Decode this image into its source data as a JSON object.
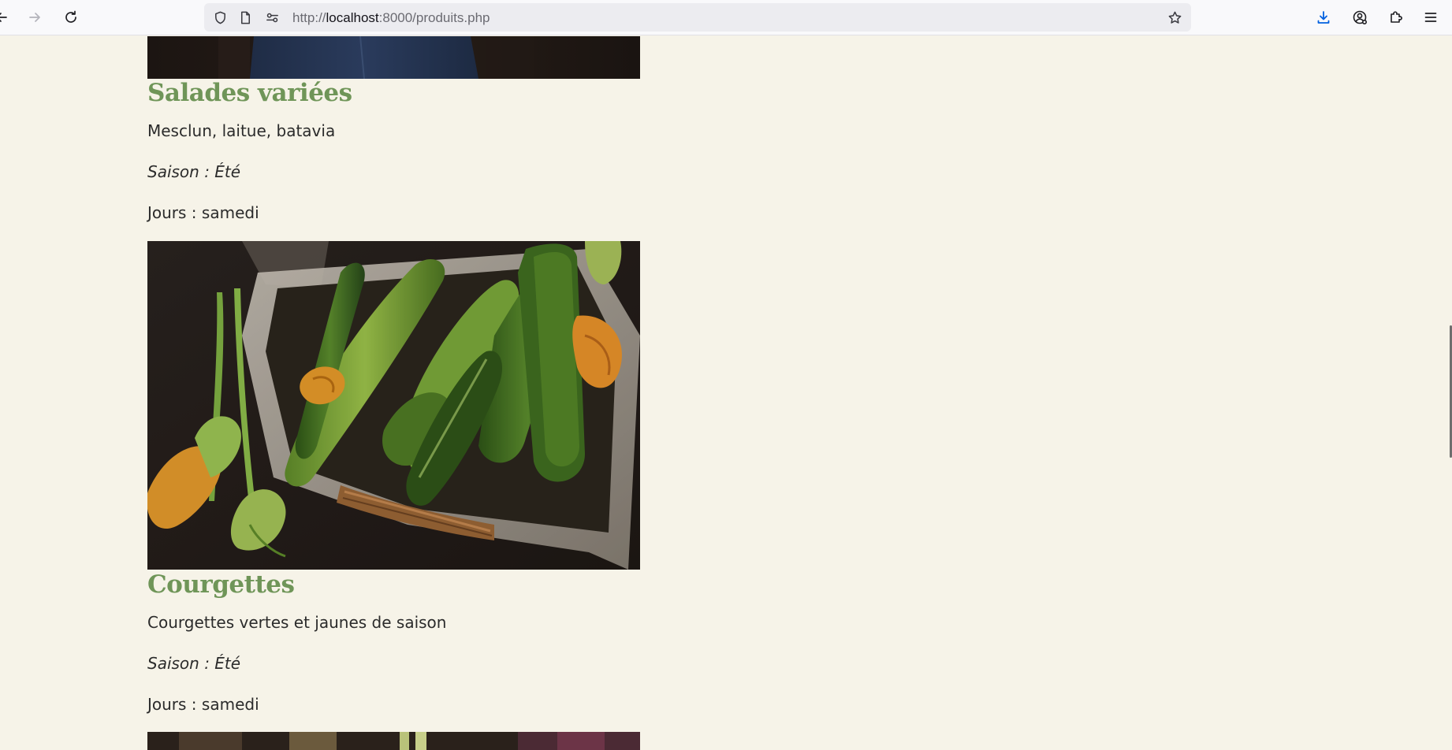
{
  "browser": {
    "url_prefix": "http://",
    "url_host": "localhost",
    "url_path": ":8000/produits.php",
    "icons": {
      "back": "back-arrow-icon",
      "forward": "forward-arrow-icon",
      "reload": "reload-icon",
      "shield": "shield-icon",
      "page": "page-icon",
      "permissions": "permissions-icon",
      "bookmark": "star-icon",
      "downloads": "download-icon",
      "account": "account-icon",
      "extensions": "puzzle-icon",
      "menu": "hamburger-menu-icon"
    },
    "accent_color": "#0060df"
  },
  "products": [
    {
      "name": "Salades variées",
      "description": "Mesclun, laitue, batavia",
      "season": "Saison : Été",
      "days": "Jours : samedi"
    },
    {
      "name": "Courgettes",
      "description": "Courgettes vertes et jaunes de saison",
      "season": "Saison : Été",
      "days": "Jours : samedi"
    }
  ],
  "colors": {
    "page_background": "#f6f3e8",
    "title_green": "#6f9558",
    "body_text": "#2b2b2b"
  }
}
